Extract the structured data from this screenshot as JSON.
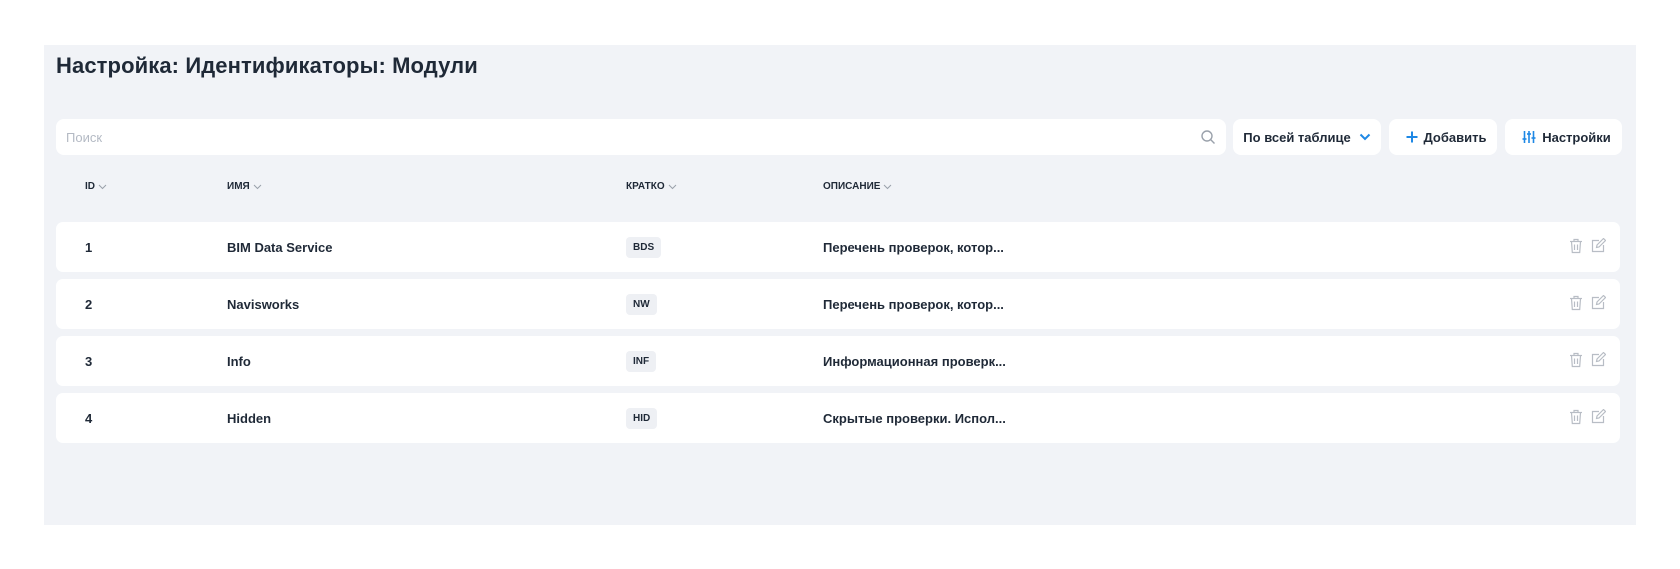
{
  "page": {
    "title": "Настройка: Идентификаторы: Модули"
  },
  "toolbar": {
    "search_placeholder": "Поиск",
    "search_value": "",
    "scope_label": "По всей таблице",
    "add_label": "Добавить",
    "settings_label": "Настройки",
    "accent_color": "#1e88e5"
  },
  "table": {
    "columns": [
      "ID",
      "ИМЯ",
      "КРАТКО",
      "ОПИСАНИЕ"
    ],
    "rows": [
      {
        "id": "1",
        "name": "BIM Data Service",
        "short": "BDS",
        "description": "Перечень проверок, котор..."
      },
      {
        "id": "2",
        "name": "Navisworks",
        "short": "NW",
        "description": "Перечень проверок, котор..."
      },
      {
        "id": "3",
        "name": "Info",
        "short": "INF",
        "description": "Информационная проверк..."
      },
      {
        "id": "4",
        "name": "Hidden",
        "short": "HID",
        "description": "Скрытые проверки. Испол..."
      }
    ]
  },
  "icons": {
    "search": "search-icon",
    "chevron": "chevron-down-icon",
    "plus": "plus-icon",
    "sliders": "sliders-icon",
    "sort": "sort-chevron-icon",
    "delete": "trash-icon",
    "edit": "edit-icon"
  }
}
